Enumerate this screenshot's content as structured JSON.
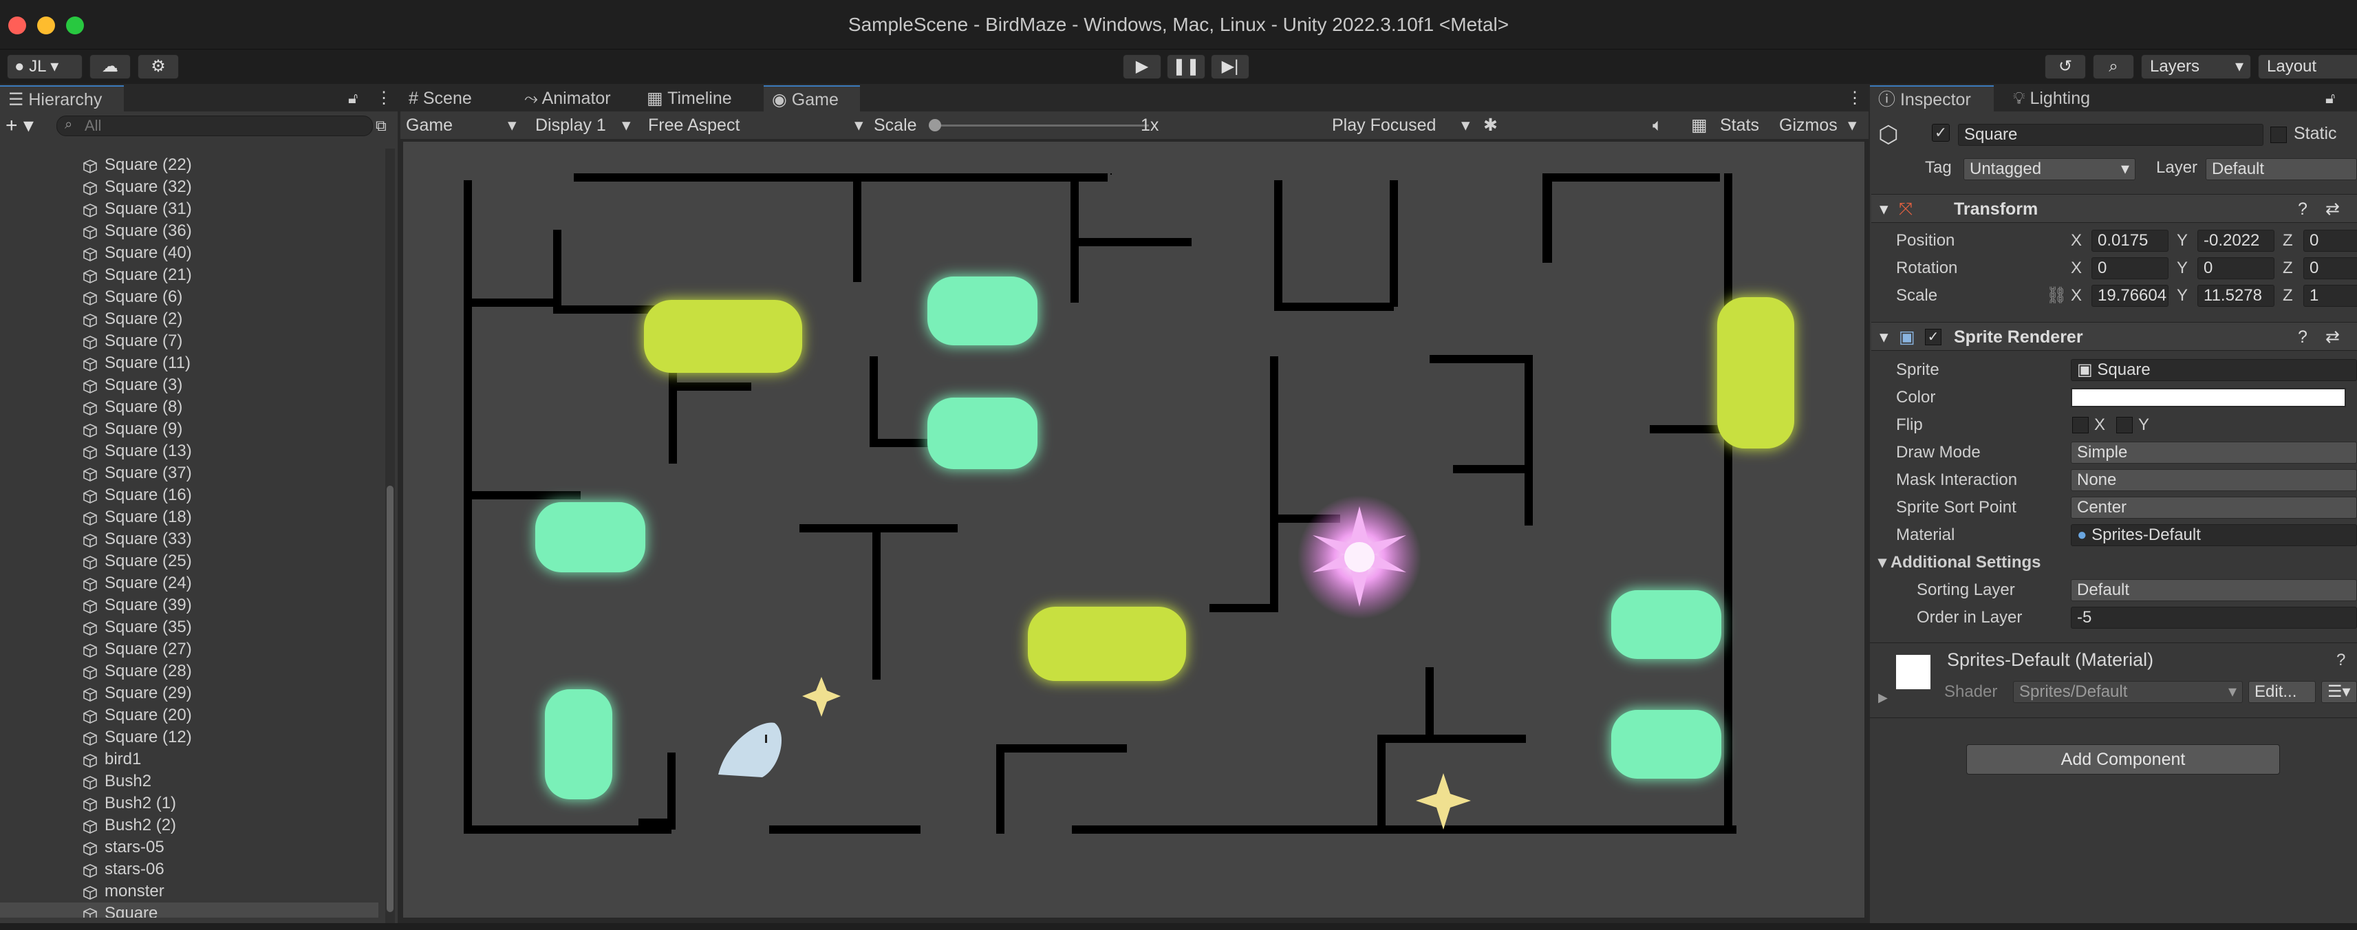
{
  "window": {
    "title": "SampleScene - BirdMaze - Windows, Mac, Linux - Unity 2022.3.10f1 <Metal>"
  },
  "toolbar": {
    "account": "JL",
    "layers": "Layers",
    "layout": "Layout"
  },
  "hierarchy": {
    "tab": "Hierarchy",
    "search_placeholder": "All",
    "add": "+",
    "items": [
      "Square (22)",
      "Square (32)",
      "Square (31)",
      "Square (36)",
      "Square (40)",
      "Square (21)",
      "Square (6)",
      "Square (2)",
      "Square (7)",
      "Square (11)",
      "Square (3)",
      "Square (8)",
      "Square (9)",
      "Square (13)",
      "Square (37)",
      "Square (16)",
      "Square (18)",
      "Square (33)",
      "Square (25)",
      "Square (24)",
      "Square (39)",
      "Square (35)",
      "Square (27)",
      "Square (28)",
      "Square (29)",
      "Square (20)",
      "Square (12)",
      "bird1",
      "Bush2",
      "Bush2 (1)",
      "Bush2 (2)",
      "stars-05",
      "stars-06",
      "monster",
      "Square"
    ],
    "selected": "Square"
  },
  "center_tabs": {
    "scene": "Scene",
    "animator": "Animator",
    "timeline": "Timeline",
    "game": "Game"
  },
  "game_bar": {
    "mode": "Game",
    "display": "Display 1",
    "aspect": "Free Aspect",
    "scale_label": "Scale",
    "scale_value": "1x",
    "play_focused": "Play Focused",
    "stats": "Stats",
    "gizmos": "Gizmos",
    "scale_fraction": 0
  },
  "inspector": {
    "tab": "Inspector",
    "lighting": "Lighting",
    "name": "Square",
    "static": "Static",
    "tag_label": "Tag",
    "tag": "Untagged",
    "layer_label": "Layer",
    "layer": "Default",
    "transform": {
      "title": "Transform",
      "position": {
        "label": "Position",
        "x": "0.0175",
        "y": "-0.2022",
        "z": "0"
      },
      "rotation": {
        "label": "Rotation",
        "x": "0",
        "y": "0",
        "z": "0"
      },
      "scale": {
        "label": "Scale",
        "x": "19.76604",
        "y": "11.5278",
        "z": "1"
      }
    },
    "sprite_renderer": {
      "title": "Sprite Renderer",
      "sprite_label": "Sprite",
      "sprite": "Square",
      "color_label": "Color",
      "flip_label": "Flip",
      "flip_x": "X",
      "flip_y": "Y",
      "draw_mode_label": "Draw Mode",
      "draw_mode": "Simple",
      "mask_label": "Mask Interaction",
      "mask": "None",
      "sort_point_label": "Sprite Sort Point",
      "sort_point": "Center",
      "material_label": "Material",
      "material": "Sprites-Default",
      "additional": "Additional Settings",
      "sorting_layer_label": "Sorting Layer",
      "sorting_layer": "Default",
      "order_label": "Order in Layer",
      "order": "-5"
    },
    "material": {
      "title": "Sprites-Default (Material)",
      "shader_label": "Shader",
      "shader": "Sprites/Default",
      "edit": "Edit..."
    },
    "add_component": "Add Component",
    "axis": {
      "x": "X",
      "y": "Y",
      "z": "Z"
    }
  },
  "colors": {
    "accent": "#3a79bb",
    "maze_bg": "#454545",
    "bush_yellow": "#c8e040",
    "bush_green": "#7af0b8",
    "monster": "#e070e0",
    "star": "#f0e090",
    "bird": "#c8dcea"
  }
}
